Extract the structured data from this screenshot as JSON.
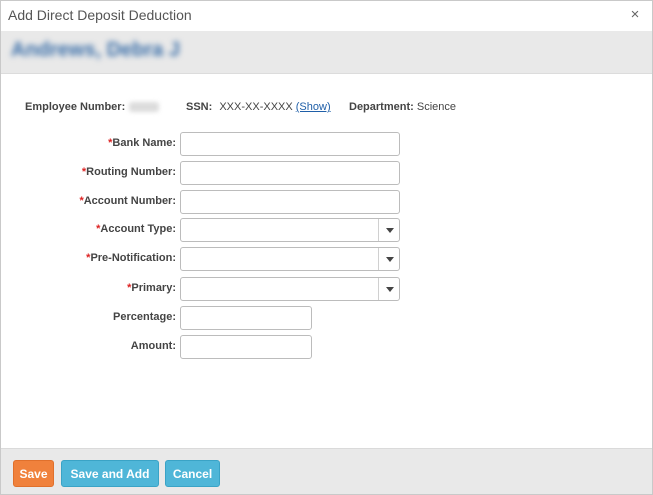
{
  "dialog": {
    "title": "Add Direct Deposit Deduction",
    "close_glyph": "×"
  },
  "employee": {
    "name": "Andrews, Debra J"
  },
  "info": {
    "employee_number_label": "Employee Number:",
    "ssn_label": "SSN:",
    "ssn_value": "XXX-XX-XXXX",
    "show_link": "(Show)",
    "department_label": "Department:",
    "department_value": "Science"
  },
  "form": {
    "required_marker": "*",
    "fields": [
      {
        "label": "Bank Name:",
        "required": true,
        "type": "text",
        "value": ""
      },
      {
        "label": "Routing Number:",
        "required": true,
        "type": "text",
        "value": ""
      },
      {
        "label": "Account Number:",
        "required": true,
        "type": "text",
        "value": ""
      },
      {
        "label": "Account Type:",
        "required": true,
        "type": "select",
        "value": ""
      },
      {
        "label": "Pre-Notification:",
        "required": true,
        "type": "select",
        "value": ""
      },
      {
        "label": "Primary:",
        "required": true,
        "type": "select",
        "value": ""
      },
      {
        "label": "Percentage:",
        "required": false,
        "type": "text",
        "value": ""
      },
      {
        "label": "Amount:",
        "required": false,
        "type": "text",
        "value": ""
      }
    ]
  },
  "footer": {
    "save_label": "Save",
    "save_and_add_label": "Save and Add",
    "cancel_label": "Cancel"
  },
  "colors": {
    "save_button": "#f0813c",
    "secondary_button": "#4fb6d8",
    "required_marker": "#dd2222",
    "link": "#1f5fa8"
  },
  "icons": {
    "close": "close-icon",
    "dropdown": "chevron-down-icon"
  }
}
